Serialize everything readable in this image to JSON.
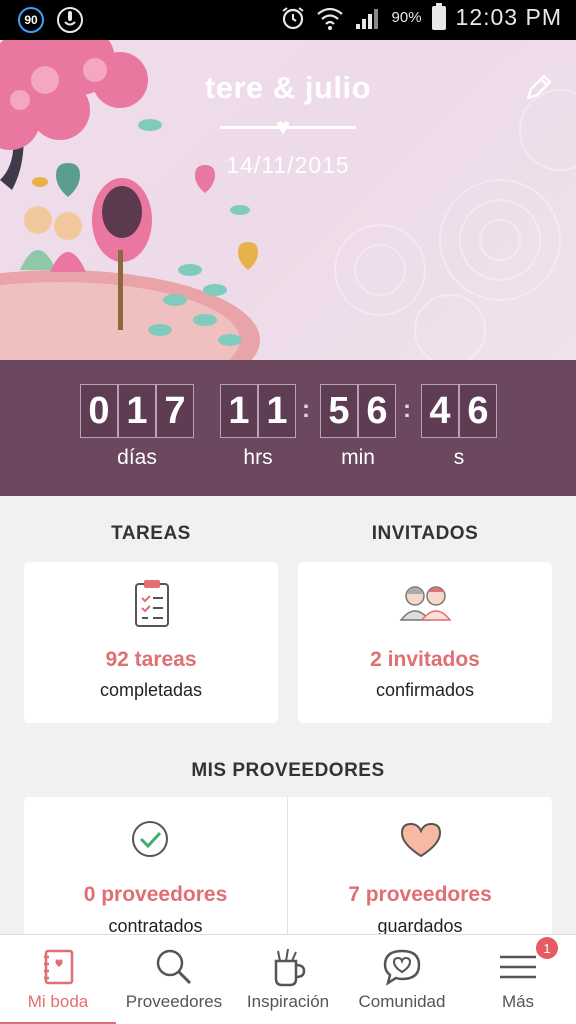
{
  "status_bar": {
    "badge": "90",
    "battery": "90%",
    "time": "12:03 PM"
  },
  "header": {
    "couple": "tere & julio",
    "date": "14/11/2015"
  },
  "countdown": {
    "days": [
      "0",
      "1",
      "7"
    ],
    "hours": [
      "1",
      "1"
    ],
    "minutes": [
      "5",
      "6"
    ],
    "seconds": [
      "4",
      "6"
    ],
    "labels": {
      "days": "días",
      "hours": "hrs",
      "minutes": "min",
      "seconds": "s"
    }
  },
  "tasks": {
    "title": "TAREAS",
    "count": "92 tareas",
    "sub": "completadas"
  },
  "guests": {
    "title": "INVITADOS",
    "count": "2 invitados",
    "sub": "confirmados"
  },
  "vendors": {
    "title": "MIS PROVEEDORES",
    "hired_count": "0 proveedores",
    "hired_sub": "contratados",
    "saved_count": "7 proveedores",
    "saved_sub": "guardados"
  },
  "nav": {
    "items": [
      {
        "label": "Mi boda",
        "icon": "notebook-icon"
      },
      {
        "label": "Proveedores",
        "icon": "search-icon"
      },
      {
        "label": "Inspiración",
        "icon": "cup-icon"
      },
      {
        "label": "Comunidad",
        "icon": "chat-heart-icon"
      },
      {
        "label": "Más",
        "icon": "menu-icon"
      }
    ],
    "badge": "1"
  },
  "colors": {
    "accent": "#e06f73",
    "countdown_bg": "#6b4760",
    "hero_bg": "#eedbe9"
  }
}
